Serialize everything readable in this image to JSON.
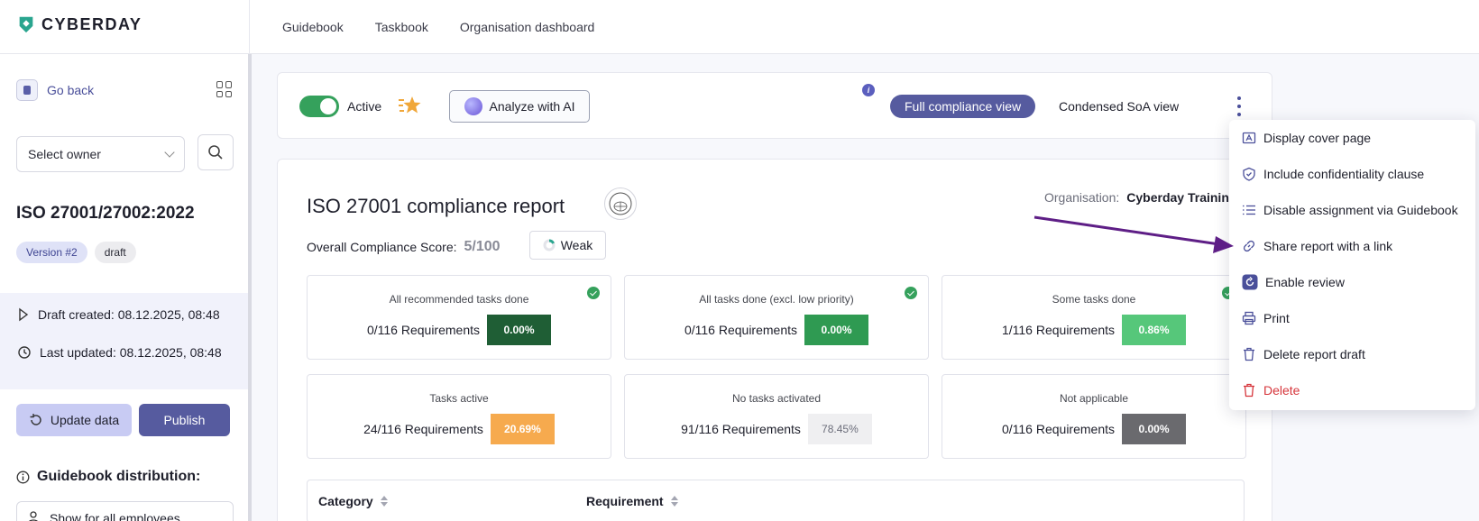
{
  "brand": {
    "name": "CYBERDAY"
  },
  "nav": {
    "items": [
      "Guidebook",
      "Taskbook",
      "Organisation dashboard"
    ]
  },
  "sidebar": {
    "go_back": "Go back",
    "owner_placeholder": "Select owner",
    "standard_title": "ISO 27001/27002:2022",
    "version_badge": "Version #2",
    "status_badge": "draft",
    "draft_created_label": "Draft created:",
    "draft_created_value": "08.12.2025, 08:48",
    "last_updated_label": "Last updated:",
    "last_updated_value": "08.12.2025, 08:48",
    "update_button": "Update data",
    "publish_button": "Publish",
    "guidebook_distribution": "Guidebook distribution:",
    "show_select": "Show for all employees"
  },
  "toolbar": {
    "active_label": "Active",
    "analyze_button": "Analyze with AI",
    "info_glyph": "i",
    "view_full": "Full compliance view",
    "view_condensed": "Condensed SoA view"
  },
  "report": {
    "title": "ISO 27001 compliance report",
    "organisation_label": "Organisation:",
    "organisation_value": "Cyberday Trainin",
    "score_label": "Overall Compliance Score:",
    "score_value": "5/100",
    "rating": "Weak",
    "tiles": [
      {
        "label": "All recommended tasks done",
        "req": "0/116 Requirements",
        "pct": "0.00%",
        "color": "#1f5e35",
        "check": true
      },
      {
        "label": "All tasks done (excl. low priority)",
        "req": "0/116 Requirements",
        "pct": "0.00%",
        "color": "#2f9a52",
        "check": true
      },
      {
        "label": "Some tasks done",
        "req": "1/116 Requirements",
        "pct": "0.86%",
        "color": "#56c77a",
        "check": true
      },
      {
        "label": "Tasks active",
        "req": "24/116 Requirements",
        "pct": "20.69%",
        "color": "#f6aa4e",
        "check": false
      },
      {
        "label": "No tasks activated",
        "req": "91/116 Requirements",
        "pct": "78.45%",
        "color": "#efeff1",
        "check": false
      },
      {
        "label": "Not applicable",
        "req": "0/116 Requirements",
        "pct": "0.00%",
        "color": "#6a6a6e",
        "check": false
      }
    ],
    "table_headers": [
      "Category",
      "Requirement"
    ]
  },
  "menu": {
    "items": [
      {
        "label": "Display cover page",
        "icon": "cover-page-icon"
      },
      {
        "label": "Include confidentiality clause",
        "icon": "shield-icon"
      },
      {
        "label": "Disable assignment via Guidebook",
        "icon": "list-icon"
      },
      {
        "label": "Share report with a link",
        "icon": "link-icon"
      },
      {
        "label": "Enable review",
        "icon": "review-icon"
      },
      {
        "label": "Print",
        "icon": "printer-icon"
      },
      {
        "label": "Delete report draft",
        "icon": "trash-icon"
      },
      {
        "label": "Delete",
        "icon": "trash-red-icon"
      }
    ]
  },
  "colors": {
    "accent": "#565b9f",
    "green": "#35a15c",
    "danger": "#d6353b",
    "arrow": "#5e1e86"
  }
}
